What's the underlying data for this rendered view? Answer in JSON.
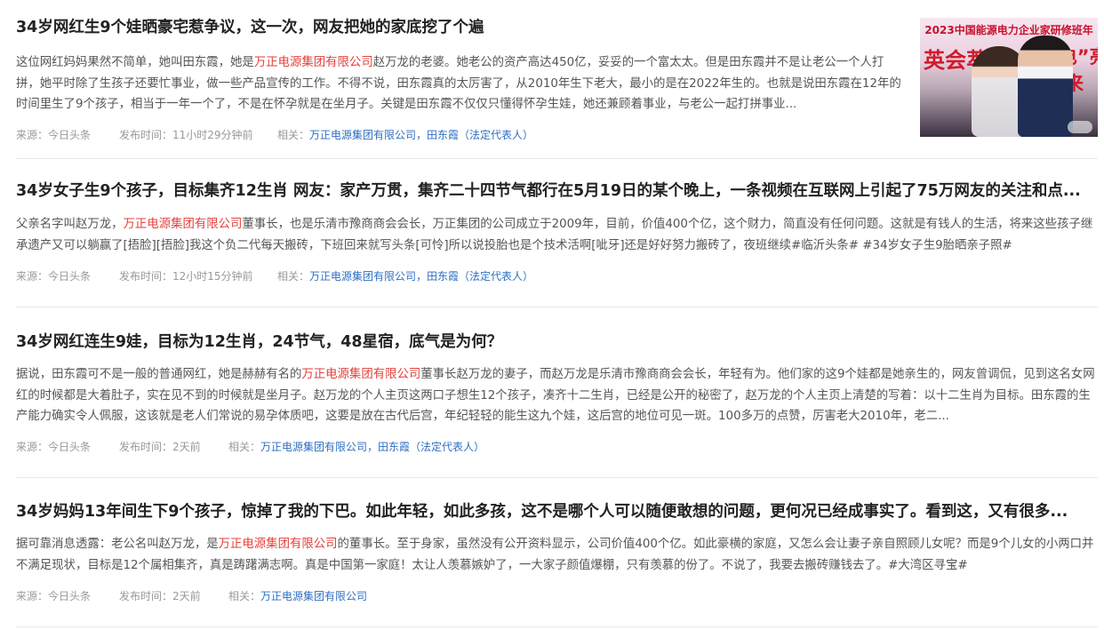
{
  "articles": [
    {
      "title": "34岁网红生9个娃晒豪宅惹争议，这一次，网友把她的家底挖了个遍",
      "summary_before": "这位网红妈妈果然不简单，她叫田东霞，她是",
      "summary_highlight": "万正电源集团有限公司",
      "summary_after": "赵万龙的老婆。她老公的资产高达450亿，妥妥的一个富太太。但是田东霞并不是让老公一个人打拼，她平时除了生孩子还要忙事业，做一些产品宣传的工作。不得不说，田东霞真的太厉害了，从2010年生下老大，最小的是在2022年生的。也就是说田东霞在12年的时间里生了9个孩子，相当于一年一个了，不是在怀孕就是在坐月子。关键是田东霞不仅仅只懂得怀孕生娃，她还兼顾着事业，与老公一起打拼事业...",
      "source": "来源：今日头条",
      "time": "发布时间：11小时29分钟前",
      "related_label": "相关：",
      "tags": [
        "万正电源集团有限公司",
        "，",
        "田东霞（法定代表人）"
      ],
      "thumbnail": {
        "banner": "2023中国能源电力企业家研修班年",
        "text_left": "英会萃",
        "text_right": "“电”亮未来"
      }
    },
    {
      "title": "34岁女子生9个孩子，目标集齐12生肖 网友：家产万贯，集齐二十四节气都行在5月19日的某个晚上，一条视频在互联网上引起了75万网友的关注和点...",
      "summary_before": "父亲名字叫赵万龙，",
      "summary_highlight": "万正电源集团有限公司",
      "summary_after": "董事长，也是乐清市豫商商会会长，万正集团的公司成立于2009年，目前，价值400个亿，这个财力，简直没有任何问题。这就是有钱人的生活，将来这些孩子继承遗产又可以躺赢了[捂脸][捂脸]我这个负二代每天搬砖，下班回来就写头条[可怜]所以说投胎也是个技术活啊[呲牙]还是好好努力搬砖了，夜班继续#临沂头条# #34岁女子生9胎晒亲子照#",
      "source": "来源：今日头条",
      "time": "发布时间：12小时15分钟前",
      "related_label": "相关：",
      "tags": [
        "万正电源集团有限公司",
        "，",
        "田东霞（法定代表人）"
      ]
    },
    {
      "title": "34岁网红连生9娃，目标为12生肖，24节气，48星宿，底气是为何？",
      "summary_before": "据说，田东霞可不是一般的普通网红，她是赫赫有名的",
      "summary_highlight": "万正电源集团有限公司",
      "summary_after": "董事长赵万龙的妻子，而赵万龙是乐清市豫商商会会长，年轻有为。他们家的这9个娃都是她亲生的，网友曾调侃，见到这名女网红的时候都是大着肚子，实在见不到的时候就是坐月子。赵万龙的个人主页这两口子想生12个孩子，凑齐十二生肖，已经是公开的秘密了，赵万龙的个人主页上清楚的写着：以十二生肖为目标。田东霞的生产能力确实令人佩服，这该就是老人们常说的易孕体质吧，这要是放在古代后宫，年纪轻轻的能生这九个娃，这后宫的地位可见一斑。100多万的点赞，厉害老大2010年，老二...",
      "source": "来源：今日头条",
      "time": "发布时间：2天前",
      "related_label": "相关：",
      "tags": [
        "万正电源集团有限公司",
        "，",
        "田东霞（法定代表人）"
      ]
    },
    {
      "title": "34岁妈妈13年间生下9个孩子，惊掉了我的下巴。如此年轻，如此多孩，这不是哪个人可以随便敢想的问题，更何况已经成事实了。看到这，又有很多...",
      "summary_before": "据可靠消息透露：老公名叫赵万龙，是",
      "summary_highlight": "万正电源集团有限公司",
      "summary_after": "的董事长。至于身家，虽然没有公开资料显示，公司价值400个亿。如此豪横的家庭，又怎么会让妻子亲自照顾儿女呢？而是9个儿女的小两口并不满足现状，目标是12个属相集齐，真是踌躇满志啊。真是中国第一家庭！太让人羡慕嫉妒了，一大家子颜值爆棚，只有羡慕的份了。不说了，我要去搬砖赚钱去了。#大湾区寻宝#",
      "source": "来源：今日头条",
      "time": "发布时间：2天前",
      "related_label": "相关：",
      "tags": [
        "万正电源集团有限公司"
      ]
    }
  ]
}
